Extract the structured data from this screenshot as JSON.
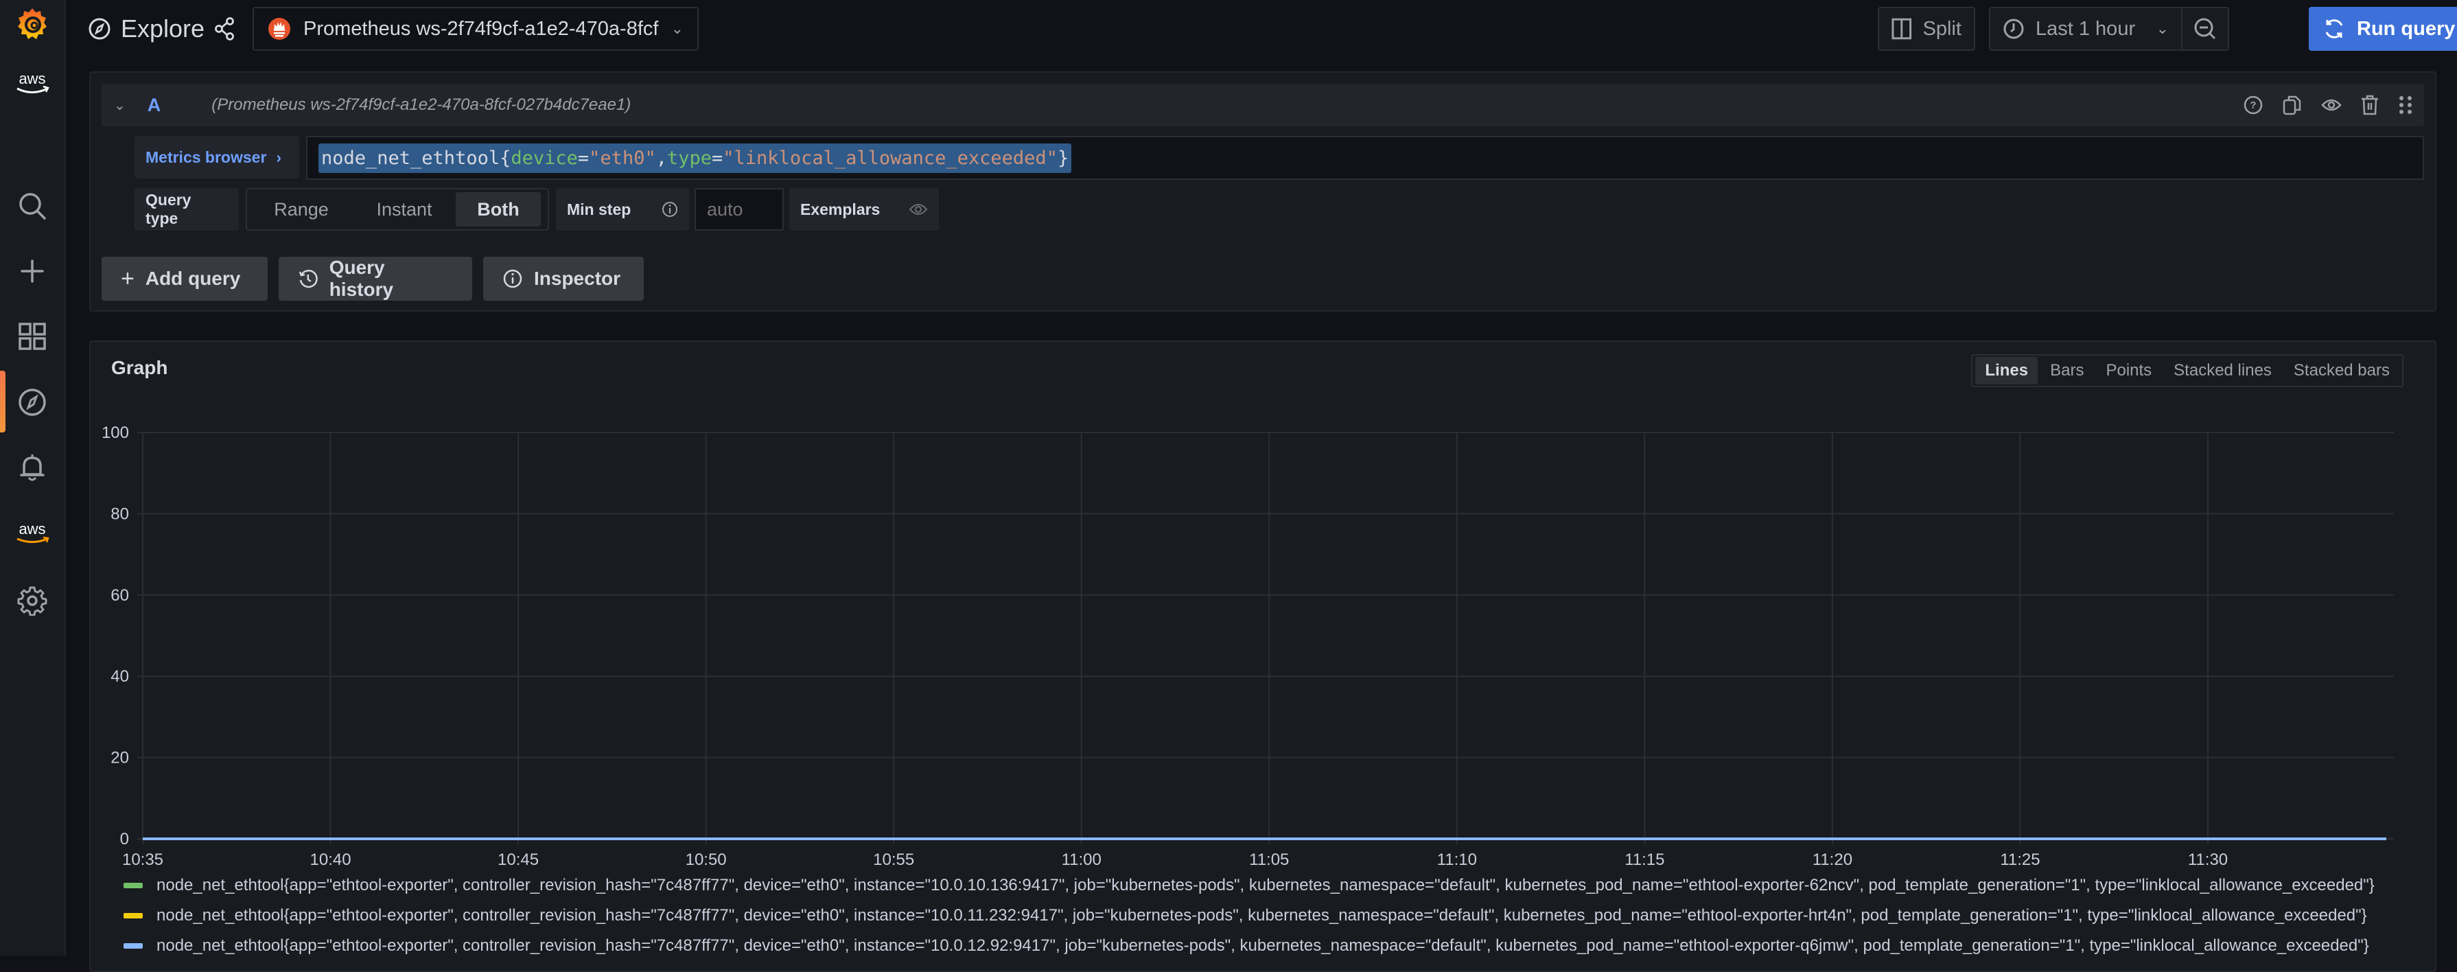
{
  "app": {
    "title": "Explore",
    "datasource": "Prometheus ws-2f74f9cf-a1e2-470a-8fcf"
  },
  "sidebar": {
    "items": [
      {
        "name": "grafana-logo"
      },
      {
        "name": "aws-logo",
        "label": "aws"
      },
      {
        "name": "search"
      },
      {
        "name": "create"
      },
      {
        "name": "dashboards"
      },
      {
        "name": "explore",
        "active": true
      },
      {
        "name": "alerting"
      },
      {
        "name": "aws-services",
        "label": "aws"
      },
      {
        "name": "configuration"
      }
    ]
  },
  "toolbar": {
    "split_label": "Split",
    "time_range_label": "Last 1 hour",
    "run_query_label": "Run query",
    "accent_color": "#3d71d9"
  },
  "query": {
    "ref_id": "A",
    "datasource_full": "(Prometheus ws-2f74f9cf-a1e2-470a-8fcf-027b4dc7eae1)",
    "metrics_browser_label": "Metrics browser",
    "expr": {
      "metric": "node_net_ethtool",
      "label1_key": "device",
      "label1_value": "\"eth0\"",
      "label2_key": "type",
      "label2_value": "\"linklocal_allowance_exceeded\""
    },
    "query_type_label": "Query type",
    "query_type_options": [
      "Range",
      "Instant",
      "Both"
    ],
    "query_type_selected": "Both",
    "min_step_label": "Min step",
    "min_step_placeholder": "auto",
    "exemplars_label": "Exemplars"
  },
  "actions": {
    "add_query": "Add query",
    "query_history": "Query history",
    "inspector": "Inspector"
  },
  "graph": {
    "title": "Graph",
    "view_options": [
      "Lines",
      "Bars",
      "Points",
      "Stacked lines",
      "Stacked bars"
    ],
    "view_selected": "Lines"
  },
  "chart_data": {
    "type": "line",
    "title": "Graph",
    "xlabel": "",
    "ylabel": "",
    "ylim": [
      0,
      100
    ],
    "y_ticks": [
      0,
      20,
      40,
      60,
      80,
      100
    ],
    "x_ticks": [
      "10:35",
      "10:40",
      "10:45",
      "10:50",
      "10:55",
      "11:00",
      "11:05",
      "11:10",
      "11:15",
      "11:20",
      "11:25",
      "11:30"
    ],
    "x_range_minutes": [
      0,
      59.75
    ],
    "grid": true,
    "legend_position": "bottom",
    "series": [
      {
        "name": "node_net_ethtool{app=\"ethtool-exporter\", controller_revision_hash=\"7c487ff77\", device=\"eth0\", instance=\"10.0.10.136:9417\", job=\"kubernetes-pods\", kubernetes_namespace=\"default\", kubernetes_pod_name=\"ethtool-exporter-62ncv\", pod_template_generation=\"1\", type=\"linklocal_allowance_exceeded\"}",
        "color": "#73bf69",
        "x": [
          0,
          59.75
        ],
        "values": [
          0,
          0
        ]
      },
      {
        "name": "node_net_ethtool{app=\"ethtool-exporter\", controller_revision_hash=\"7c487ff77\", device=\"eth0\", instance=\"10.0.11.232:9417\", job=\"kubernetes-pods\", kubernetes_namespace=\"default\", kubernetes_pod_name=\"ethtool-exporter-hrt4n\", pod_template_generation=\"1\", type=\"linklocal_allowance_exceeded\"}",
        "color": "#f2cc0c",
        "x": [
          0,
          59.75
        ],
        "values": [
          0,
          0
        ]
      },
      {
        "name": "node_net_ethtool{app=\"ethtool-exporter\", controller_revision_hash=\"7c487ff77\", device=\"eth0\", instance=\"10.0.12.92:9417\", job=\"kubernetes-pods\", kubernetes_namespace=\"default\", kubernetes_pod_name=\"ethtool-exporter-q6jmw\", pod_template_generation=\"1\", type=\"linklocal_allowance_exceeded\"}",
        "color": "#8ab8ff",
        "x": [
          0,
          59.75
        ],
        "values": [
          0,
          0
        ]
      }
    ]
  }
}
